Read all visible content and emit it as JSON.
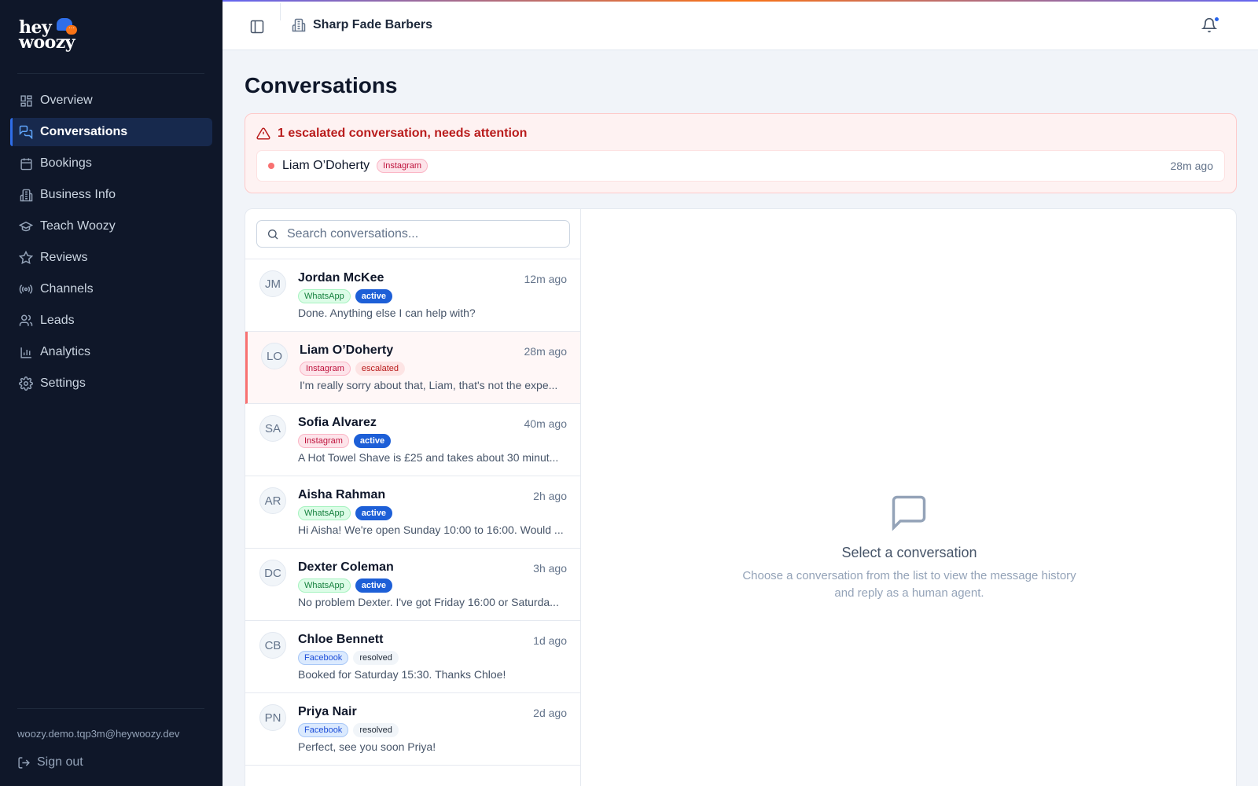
{
  "brand": {
    "logo_line1": "hey",
    "logo_line2": "woozy"
  },
  "nav": {
    "items": [
      {
        "label": "Overview",
        "icon": "dashboard-icon"
      },
      {
        "label": "Conversations",
        "icon": "chat-icon",
        "active": true
      },
      {
        "label": "Bookings",
        "icon": "calendar-icon"
      },
      {
        "label": "Business Info",
        "icon": "building-icon"
      },
      {
        "label": "Teach Woozy",
        "icon": "graduation-cap-icon"
      },
      {
        "label": "Reviews",
        "icon": "star-icon"
      },
      {
        "label": "Channels",
        "icon": "radio-icon"
      },
      {
        "label": "Leads",
        "icon": "users-icon"
      },
      {
        "label": "Analytics",
        "icon": "bar-chart-icon"
      },
      {
        "label": "Settings",
        "icon": "gear-icon"
      }
    ]
  },
  "account": {
    "email": "woozy.demo.tqp3m@heywoozy.dev",
    "sign_out": "Sign out"
  },
  "header": {
    "business_name": "Sharp Fade Barbers"
  },
  "page": {
    "title": "Conversations"
  },
  "alert": {
    "title": "1 escalated conversation, needs attention",
    "item": {
      "name": "Liam O’Doherty",
      "channel": "Instagram",
      "time": "28m ago"
    }
  },
  "search": {
    "placeholder": "Search conversations..."
  },
  "conversations": [
    {
      "initials": "JM",
      "name": "Jordan McKee",
      "time": "12m ago",
      "channel": "WhatsApp",
      "status": "active",
      "preview": "Done. Anything else I can help with?"
    },
    {
      "initials": "LO",
      "name": "Liam O’Doherty",
      "time": "28m ago",
      "channel": "Instagram",
      "status": "escalated",
      "preview": "I'm really sorry about that, Liam, that's not the expe..."
    },
    {
      "initials": "SA",
      "name": "Sofia Alvarez",
      "time": "40m ago",
      "channel": "Instagram",
      "status": "active",
      "preview": "A Hot Towel Shave is £25 and takes about 30 minut..."
    },
    {
      "initials": "AR",
      "name": "Aisha Rahman",
      "time": "2h ago",
      "channel": "WhatsApp",
      "status": "active",
      "preview": "Hi Aisha! We're open Sunday 10:00 to 16:00. Would ..."
    },
    {
      "initials": "DC",
      "name": "Dexter Coleman",
      "time": "3h ago",
      "channel": "WhatsApp",
      "status": "active",
      "preview": "No problem Dexter. I've got Friday 16:00 or Saturda..."
    },
    {
      "initials": "CB",
      "name": "Chloe Bennett",
      "time": "1d ago",
      "channel": "Facebook",
      "status": "resolved",
      "preview": "Booked for Saturday 15:30. Thanks Chloe!"
    },
    {
      "initials": "PN",
      "name": "Priya Nair",
      "time": "2d ago",
      "channel": "Facebook",
      "status": "resolved",
      "preview": "Perfect, see you soon Priya!"
    }
  ],
  "empty_state": {
    "icon": "message-square-icon",
    "title": "Select a conversation",
    "description": "Choose a conversation from the list to view the message history and reply as a human agent."
  },
  "colors": {
    "sidebar_bg": "#0f1729",
    "accent": "#2f6ee8",
    "alert_bg": "#fef2f2",
    "alert_text": "#b91c1c"
  }
}
